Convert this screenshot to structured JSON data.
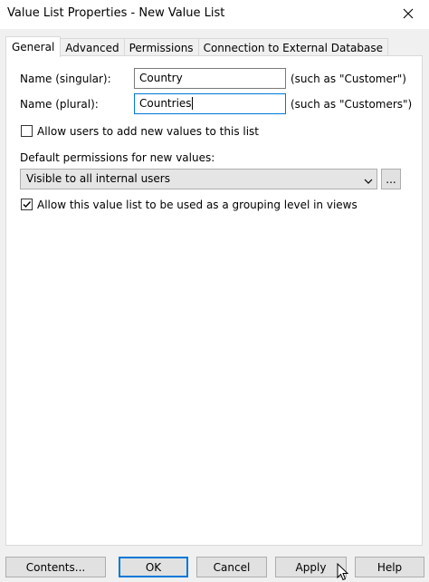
{
  "window": {
    "title": "Value List Properties - New Value List"
  },
  "tabs": [
    {
      "label": "General",
      "active": true
    },
    {
      "label": "Advanced"
    },
    {
      "label": "Permissions"
    },
    {
      "label": "Connection to External Database"
    }
  ],
  "general": {
    "singular_label": "Name (singular):",
    "singular_value": "Country",
    "singular_hint": "(such as \"Customer\")",
    "plural_label": "Name (plural):",
    "plural_value": "Countries",
    "plural_hint": "(such as \"Customers\")",
    "allow_add_label": "Allow users to add new values to this list",
    "allow_add_checked": false,
    "default_permissions_label": "Default permissions for new values:",
    "default_permissions_value": "Visible to all internal users",
    "browse_label": "...",
    "grouping_label": "Allow this value list to be used as a grouping level in views",
    "grouping_checked": true
  },
  "buttons": {
    "contents": "Contents...",
    "ok": "OK",
    "cancel": "Cancel",
    "apply": "Apply",
    "help": "Help"
  },
  "colors": {
    "focus": "#0078d7",
    "panel": "#ffffff",
    "dialog": "#f0f0f0"
  },
  "icons": {
    "close": "close-icon",
    "dropdown": "chevron-down-icon",
    "check": "checkmark-icon",
    "pointer": "mouse-pointer-icon"
  }
}
